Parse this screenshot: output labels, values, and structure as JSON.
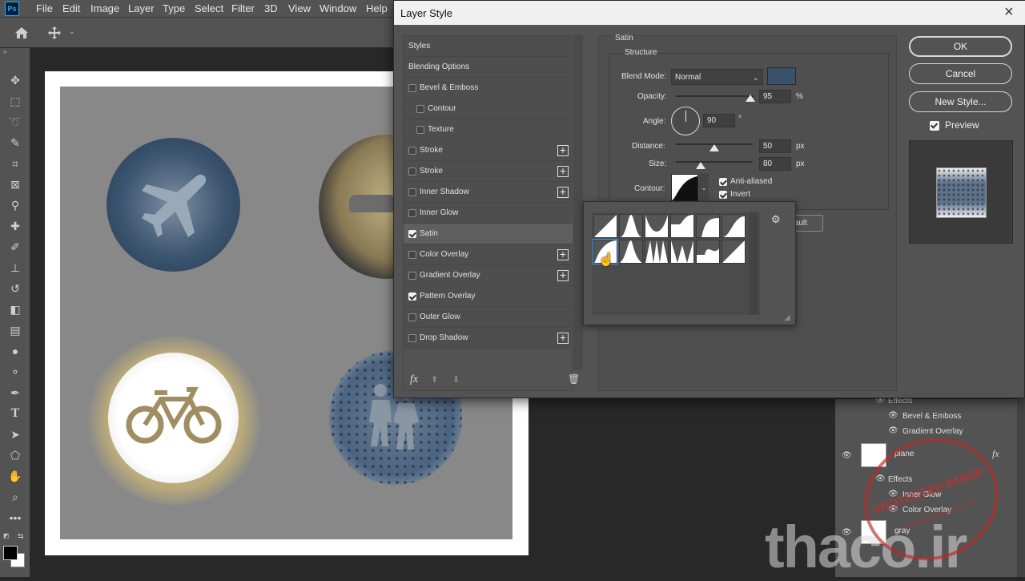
{
  "app": {
    "logo": "Ps",
    "menu": [
      "File",
      "Edit",
      "Image",
      "Layer",
      "Type",
      "Select",
      "Filter",
      "3D",
      "View",
      "Window",
      "Help"
    ]
  },
  "dialog": {
    "title": "Layer Style",
    "styles": [
      {
        "label": "Styles",
        "kind": "header"
      },
      {
        "label": "Blending Options",
        "kind": "header"
      },
      {
        "label": "Bevel & Emboss",
        "checked": false,
        "plus": false,
        "indent": 0
      },
      {
        "label": "Contour",
        "checked": false,
        "plus": false,
        "indent": 1
      },
      {
        "label": "Texture",
        "checked": false,
        "plus": false,
        "indent": 1
      },
      {
        "label": "Stroke",
        "checked": false,
        "plus": true,
        "indent": 0
      },
      {
        "label": "Stroke",
        "checked": false,
        "plus": true,
        "indent": 0
      },
      {
        "label": "Inner Shadow",
        "checked": false,
        "plus": true,
        "indent": 0
      },
      {
        "label": "Inner Glow",
        "checked": false,
        "plus": false,
        "indent": 0
      },
      {
        "label": "Satin",
        "checked": true,
        "plus": false,
        "indent": 0,
        "selected": true
      },
      {
        "label": "Color Overlay",
        "checked": false,
        "plus": true,
        "indent": 0
      },
      {
        "label": "Gradient Overlay",
        "checked": false,
        "plus": true,
        "indent": 0
      },
      {
        "label": "Pattern Overlay",
        "checked": true,
        "plus": false,
        "indent": 0
      },
      {
        "label": "Outer Glow",
        "checked": false,
        "plus": false,
        "indent": 0
      },
      {
        "label": "Drop Shadow",
        "checked": false,
        "plus": true,
        "indent": 0
      }
    ],
    "fx_label": "fx",
    "satin": {
      "section": "Satin",
      "group": "Structure",
      "blend_label": "Blend Mode:",
      "blend_value": "Normal",
      "swatch_color": "#3b506a",
      "opacity_label": "Opacity:",
      "opacity_value": "95",
      "opacity_unit": "%",
      "opacity_level": 0.95,
      "angle_label": "Angle:",
      "angle_value": "90",
      "angle_unit": "°",
      "distance_label": "Distance:",
      "distance_value": "50",
      "distance_unit": "px",
      "distance_level": 0.5,
      "size_label": "Size:",
      "size_value": "80",
      "size_unit": "px",
      "size_level": 0.32,
      "contour_label": "Contour:",
      "antialiased_label": "Anti-aliased",
      "antialiased": true,
      "invert_label": "Invert",
      "invert": true,
      "default_fragment": "fault"
    },
    "buttons": {
      "ok": "OK",
      "cancel": "Cancel",
      "new_style": "New Style...",
      "preview": "Preview",
      "preview_checked": true
    }
  },
  "layers": {
    "rows": [
      {
        "type": "effects",
        "label": "Effects"
      },
      {
        "type": "effect",
        "label": "Bevel & Emboss"
      },
      {
        "type": "effect",
        "label": "Gradient Overlay"
      },
      {
        "type": "layer",
        "label": "plane",
        "fx": "fx"
      },
      {
        "type": "effects",
        "label": "Effects"
      },
      {
        "type": "effect",
        "label": "Inner Glow"
      },
      {
        "type": "effect",
        "label": "Color Overlay"
      },
      {
        "type": "layer",
        "label": "gray"
      }
    ]
  },
  "watermark": {
    "text": "thaco.ir",
    "stamp_text": "PROTECTED IMAGE",
    "stamp_sub": "My Website Name & URL Here"
  }
}
